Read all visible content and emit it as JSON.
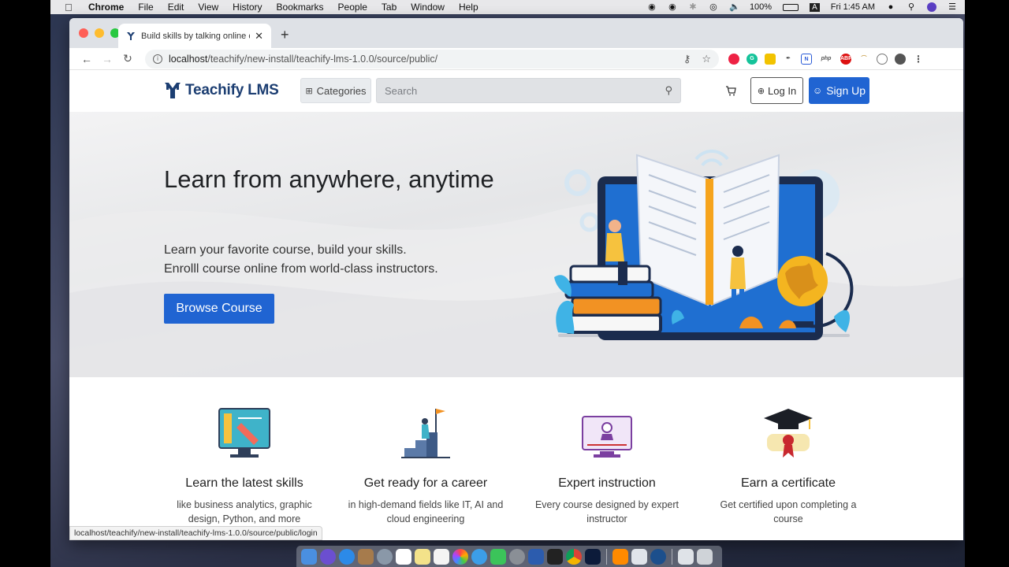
{
  "menubar": {
    "app_name": "Chrome",
    "items": [
      "File",
      "Edit",
      "View",
      "History",
      "Bookmarks",
      "People",
      "Tab",
      "Window",
      "Help"
    ],
    "battery": "100%",
    "input_source": "A",
    "clock": "Fri 1:45 AM"
  },
  "browser": {
    "tab_title": "Build skills by talking online co",
    "url_host": "localhost",
    "url_path": "/teachify/new-install/teachify-lms-1.0.0/source/public/",
    "status_url": "localhost/teachify/new-install/teachify-lms-1.0.0/source/public/login"
  },
  "header": {
    "logo_text": "Teachify LMS",
    "categories_label": "Categories",
    "search_placeholder": "Search",
    "login_label": "Log In",
    "signup_label": "Sign Up"
  },
  "hero": {
    "title": "Learn from anywhere, anytime",
    "subtitle_line1": "Learn your favorite course, build your skills.",
    "subtitle_line2": "Enrolll course online from world-class instructors.",
    "cta_label": "Browse Course"
  },
  "features": [
    {
      "title": "Learn the latest skills",
      "desc": "like business analytics, graphic design, Python, and more"
    },
    {
      "title": "Get ready for a career",
      "desc": "in high-demand fields like IT, AI and cloud engineering"
    },
    {
      "title": "Expert instruction",
      "desc": "Every course designed by expert instructor"
    },
    {
      "title": "Earn a certificate",
      "desc": "Get certified upon completing a course"
    }
  ],
  "colors": {
    "brand": "#1c3e72",
    "primary": "#2064d2"
  }
}
